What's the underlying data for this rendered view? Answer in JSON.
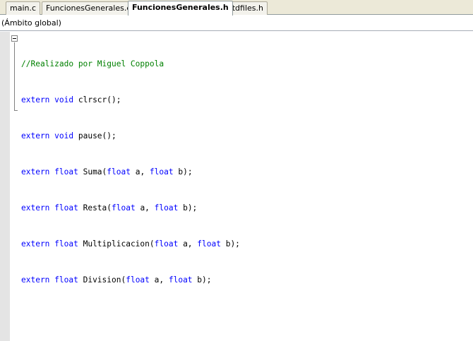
{
  "tabs": [
    {
      "label": "main.c",
      "active": false
    },
    {
      "label": "FuncionesGenerales.c",
      "active": false
    },
    {
      "label": "FuncionesGenerales.h",
      "active": true
    },
    {
      "label": "stdfiles.h",
      "active": false
    }
  ],
  "scope": {
    "value": "(Ámbito global)"
  },
  "code": {
    "line1": {
      "comment": "//Realizado por Miguel Coppola"
    },
    "line2": {
      "kw1": "extern",
      "kw2": "void",
      "rest": " clrscr();"
    },
    "line3": {
      "kw1": "extern",
      "kw2": "void",
      "rest": " pause();"
    },
    "line4": {
      "kw1": "extern",
      "kw2": "float",
      "name": " Suma(",
      "kw3": "float",
      "mid": " a, ",
      "kw4": "float",
      "end": " b);"
    },
    "line5": {
      "kw1": "extern",
      "kw2": "float",
      "name": " Resta(",
      "kw3": "float",
      "mid": " a, ",
      "kw4": "float",
      "end": " b);"
    },
    "line6": {
      "kw1": "extern",
      "kw2": "float",
      "name": " Multiplicacion(",
      "kw3": "float",
      "mid": " a, ",
      "kw4": "float",
      "end": " b);"
    },
    "line7": {
      "kw1": "extern",
      "kw2": "float",
      "name": " Division(",
      "kw3": "float",
      "mid": " a, ",
      "kw4": "float",
      "end": " b);"
    }
  },
  "colors": {
    "keyword": "#0000ff",
    "comment": "#008000",
    "text": "#000000",
    "gutter": "#e4e4e4"
  },
  "icons": [
    "fold-collapse-icon"
  ]
}
